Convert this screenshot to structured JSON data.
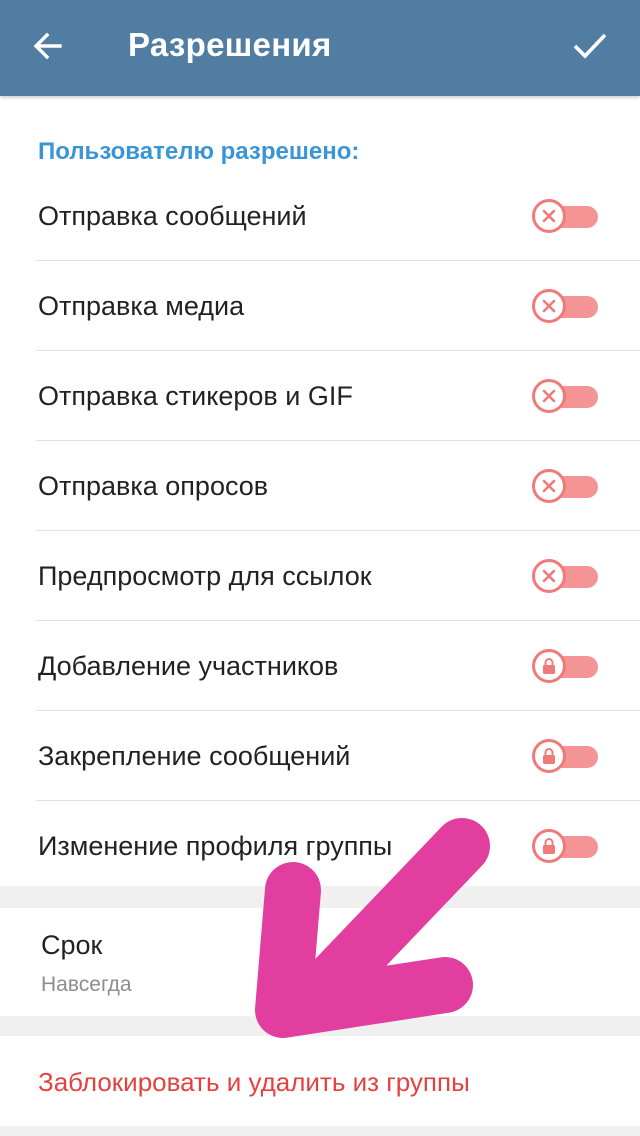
{
  "header": {
    "title": "Разрешения",
    "back_icon": "arrow-left-icon",
    "done_icon": "checkmark-icon",
    "background_color": "#527da3"
  },
  "permissions": {
    "section_title": "Пользователю разрешено:",
    "items": [
      {
        "label": "Отправка сообщений",
        "state": "off",
        "icon": "close-icon"
      },
      {
        "label": "Отправка медиа",
        "state": "off",
        "icon": "close-icon"
      },
      {
        "label": "Отправка стикеров и GIF",
        "state": "off",
        "icon": "close-icon"
      },
      {
        "label": "Отправка опросов",
        "state": "off",
        "icon": "close-icon"
      },
      {
        "label": "Предпросмотр для ссылок",
        "state": "off",
        "icon": "close-icon"
      },
      {
        "label": "Добавление участников",
        "state": "locked",
        "icon": "lock-icon"
      },
      {
        "label": "Закрепление сообщений",
        "state": "locked",
        "icon": "lock-icon"
      },
      {
        "label": "Изменение профиля группы",
        "state": "locked",
        "icon": "lock-icon"
      }
    ]
  },
  "term": {
    "title": "Срок",
    "value": "Навсегда"
  },
  "ban": {
    "label": "Заблокировать и удалить из группы"
  },
  "annotation": {
    "icon": "pointer-arrow-annotation",
    "color": "#e0349a"
  }
}
